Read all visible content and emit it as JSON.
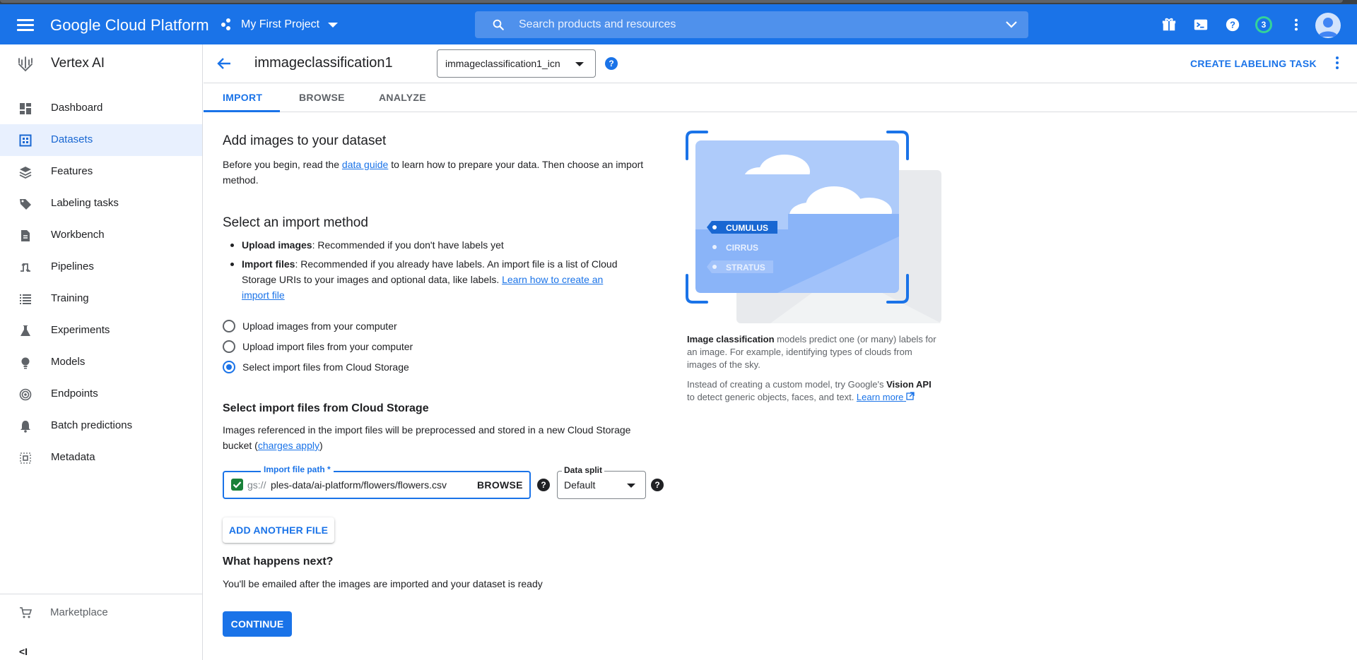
{
  "topbar": {
    "brand": "Google Cloud Platform",
    "project": "My First Project",
    "search_placeholder": "Search products and resources",
    "notification_count": "3"
  },
  "sidebar": {
    "title": "Vertex AI",
    "items": [
      {
        "label": "Dashboard",
        "icon": "dashboard-icon"
      },
      {
        "label": "Datasets",
        "icon": "datasets-icon",
        "active": true
      },
      {
        "label": "Features",
        "icon": "features-icon"
      },
      {
        "label": "Labeling tasks",
        "icon": "label-icon"
      },
      {
        "label": "Workbench",
        "icon": "workbench-icon"
      },
      {
        "label": "Pipelines",
        "icon": "pipelines-icon"
      },
      {
        "label": "Training",
        "icon": "training-icon"
      },
      {
        "label": "Experiments",
        "icon": "experiments-icon"
      },
      {
        "label": "Models",
        "icon": "models-icon"
      },
      {
        "label": "Endpoints",
        "icon": "endpoints-icon"
      },
      {
        "label": "Batch predictions",
        "icon": "bell-icon"
      },
      {
        "label": "Metadata",
        "icon": "metadata-icon"
      }
    ],
    "marketplace": "Marketplace",
    "collapse": "<I"
  },
  "header": {
    "title": "immageclassification1",
    "dataset_select": "immageclassification1_icn",
    "help": "?",
    "create_task": "CREATE LABELING TASK"
  },
  "tabs": [
    "IMPORT",
    "BROWSE",
    "ANALYZE"
  ],
  "main": {
    "add_title": "Add images to your dataset",
    "intro_before": "Before you begin, read the ",
    "intro_link": "data guide",
    "intro_after": " to learn how to prepare your data. Then choose an import method.",
    "method_title": "Select an import method",
    "bullets": [
      {
        "bold": "Upload images",
        "text": ": Recommended if you don't have labels yet"
      },
      {
        "bold": "Import files",
        "text": ": Recommended if you already have labels. An import file is a list of Cloud Storage URIs to your images and optional data, like labels. ",
        "link": "Learn how to create an import file"
      }
    ],
    "radios": [
      {
        "label": "Upload images from your computer",
        "checked": false
      },
      {
        "label": "Upload import files from your computer",
        "checked": false
      },
      {
        "label": "Select import files from Cloud Storage",
        "checked": true
      }
    ],
    "storage_title": "Select import files from Cloud Storage",
    "storage_text_before": "Images referenced in the import files will be preprocessed and stored in a new Cloud Storage bucket (",
    "storage_link": "charges apply",
    "storage_text_after": ")",
    "file_label": "Import file path *",
    "file_prefix": "gs://",
    "file_value": "ples-data/ai-platform/flowers/flowers.csv",
    "browse": "BROWSE",
    "split_label": "Data split",
    "split_value": "Default",
    "add_file": "ADD ANOTHER FILE",
    "next_title": "What happens next?",
    "next_text": "You'll be emailed after the images are imported and your dataset is ready",
    "continue": "CONTINUE"
  },
  "illustration": {
    "tags": [
      "CUMULUS",
      "CIRRUS",
      "STRATUS"
    ]
  },
  "info": {
    "p1_bold": "Image classification",
    "p1_text": " models predict one (or many) labels for an image. For example, identifying types of clouds from images of the sky.",
    "p2_text": "Instead of creating a custom model, try Google's ",
    "p2_bold": "Vision API",
    "p2_text2": " to detect generic objects, faces, and text. ",
    "p2_link": "Learn more"
  },
  "colors": {
    "primary": "#1a73e8",
    "active_bg": "#e8f0fe",
    "check_green": "#188038"
  }
}
